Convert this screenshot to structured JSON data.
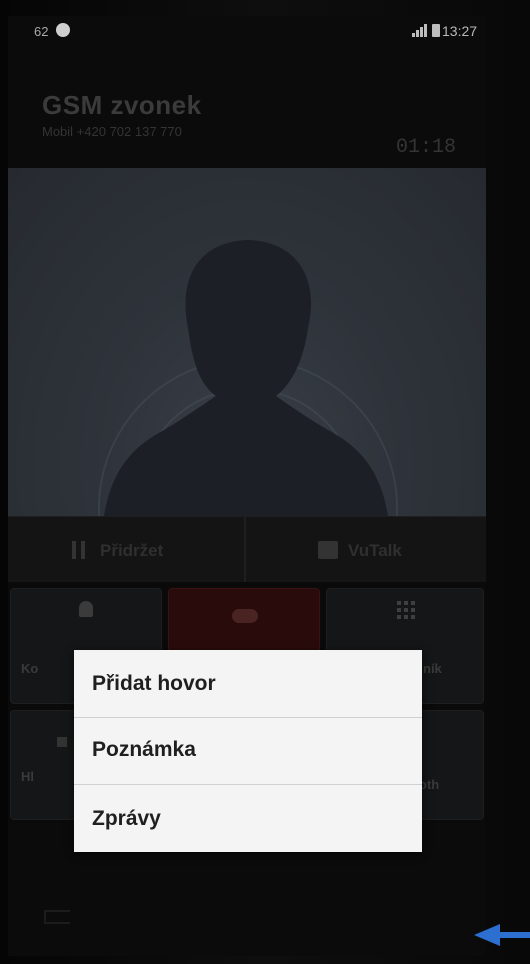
{
  "status_bar": {
    "battery_percent": "62",
    "time": "13:27"
  },
  "call": {
    "caller_name": "GSM zvonek",
    "caller_number": "Mobil +420 702 137 770",
    "duration": "01:18"
  },
  "actions": {
    "hold_label": "Přidržet",
    "vutalk_label": "VuTalk"
  },
  "grid": {
    "contacts_partial": "Ko",
    "keypad_partial": "ník",
    "speaker_partial": "Hl",
    "bluetooth_partial": "oth"
  },
  "menu": {
    "items": [
      {
        "label": "Přidat hovor"
      },
      {
        "label": "Poznámka"
      },
      {
        "label": "Zprávy"
      }
    ]
  },
  "colors": {
    "menu_bg": "#f4f4f4",
    "arrow": "#2d6fd0",
    "end_call": "#2a0b0b"
  },
  "icons": [
    "hold-icon",
    "vutalk-icon",
    "contact-icon",
    "end-call-icon",
    "keypad-icon",
    "speaker-icon",
    "back-icon",
    "signal-icon",
    "battery-icon"
  ]
}
